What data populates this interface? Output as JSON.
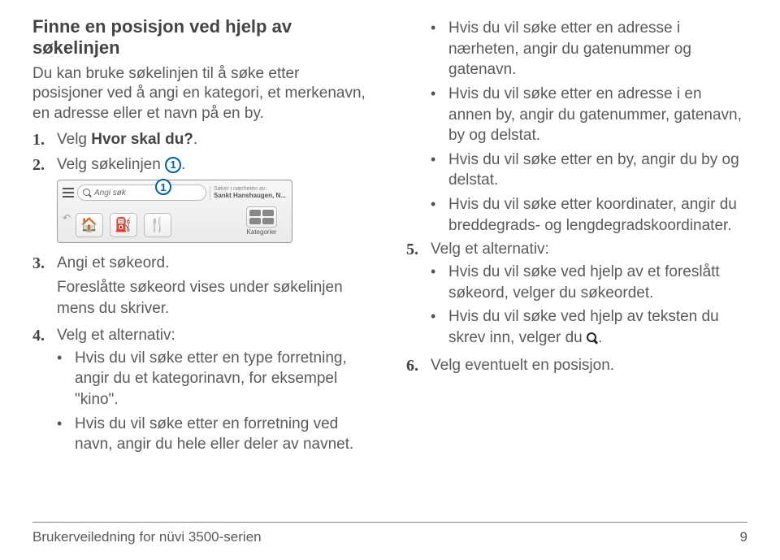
{
  "title": "Finne en posisjon ved hjelp av søkelinjen",
  "intro": "Du kan bruke søkelinjen til å søke etter posisjoner ved å angi en kategori, et merkenavn, en adresse eller et navn på en by.",
  "left_steps": {
    "s1": {
      "num": "1.",
      "prefix": "Velg ",
      "bold": "Hvor skal du?",
      "suffix": "."
    },
    "s2": {
      "num": "2.",
      "text": "Velg søkelinjen ",
      "callout": "1",
      "suffix": "."
    },
    "device": {
      "search_placeholder": "Angi søk",
      "near_label": "Søker i nærheten av:",
      "near_value": "Sankt Hanshaugen, N...",
      "overlay_callout": "1",
      "categories_label": "Kategorier"
    },
    "s3": {
      "num": "3.",
      "line1": "Angi et søkeord.",
      "line2": "Foreslåtte søkeord vises under søkelinjen mens du skriver."
    },
    "s4": {
      "num": "4.",
      "lead": "Velg et alternativ:",
      "bullets": [
        "Hvis du vil søke etter en type forretning, angir du et kategorinavn, for eksempel \"kino\".",
        "Hvis du vil søke etter en forretning ved navn, angir du hele eller deler av navnet."
      ]
    }
  },
  "right": {
    "cont_bullets": [
      "Hvis du vil søke etter en adresse i nærheten, angir du gatenummer og gatenavn.",
      "Hvis du vil søke etter en adresse i en annen by, angir du gatenummer, gatenavn, by og delstat.",
      "Hvis du vil søke etter en by, angir du by og delstat.",
      "Hvis du vil søke etter koordinater, angir du breddegrads- og lengdegradskoordinater."
    ],
    "s5": {
      "num": "5.",
      "lead": "Velg et alternativ:",
      "b1": "Hvis du vil søke ved hjelp av et foreslått søkeord, velger du søkeordet.",
      "b2_pre": "Hvis du vil søke ved hjelp av teksten du skrev inn, velger du ",
      "b2_post": "."
    },
    "s6": {
      "num": "6.",
      "text": "Velg eventuelt en posisjon."
    }
  },
  "footer": {
    "left": "Brukerveiledning for nüvi 3500-serien",
    "right": "9"
  }
}
